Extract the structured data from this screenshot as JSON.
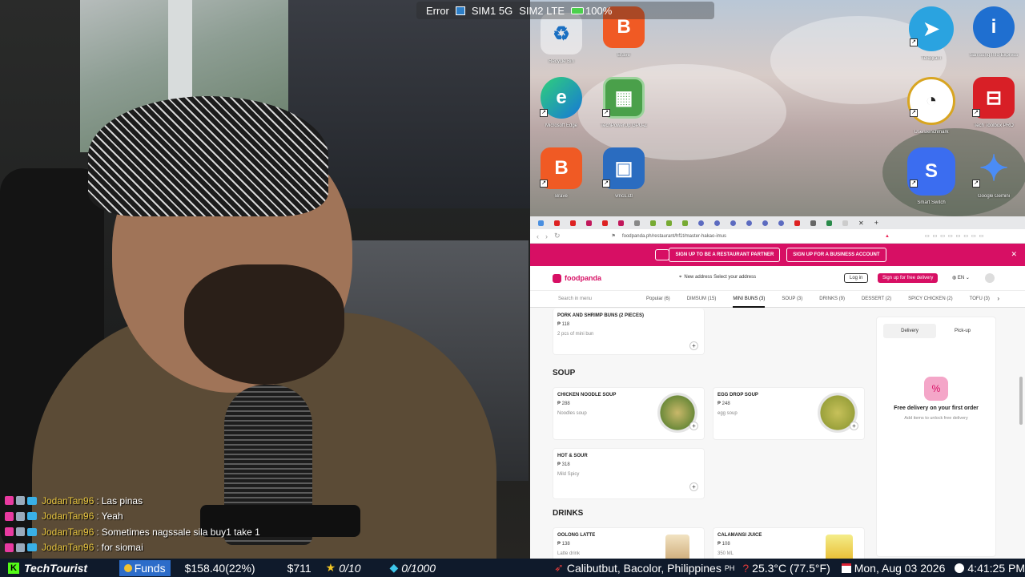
{
  "statusbar": {
    "error": "Error",
    "sim1": "SIM1 5G",
    "sim2": "SIM2 LTE",
    "battery": "100%"
  },
  "chat": [
    {
      "user": "JodanTan96",
      "msg": "Las pinas"
    },
    {
      "user": "JodanTan96",
      "msg": "Yeah"
    },
    {
      "user": "JodanTan96",
      "msg": "Sometimes nagssale sila buy1 take 1"
    },
    {
      "user": "JodanTan96",
      "msg": "for siomai"
    }
  ],
  "desktop": {
    "icons": [
      {
        "name": "recycle-bin-icon",
        "label": "Recycle Bin"
      },
      {
        "name": "brave-icon",
        "label": "Brave"
      },
      {
        "name": "edge-icon",
        "label": "Microsoft Edge"
      },
      {
        "name": "bios-chip-icon",
        "label": "TechPowerUp GPU-Z"
      },
      {
        "name": "brave-icon",
        "label": "Brave"
      },
      {
        "name": "remote-pc-icon",
        "label": "vmcs.ctl"
      },
      {
        "name": "telegram-icon",
        "label": "Telegram"
      },
      {
        "name": "info-icon",
        "label": "Samsung Info Express"
      },
      {
        "name": "speedometer-icon",
        "label": "UserBenchmark"
      },
      {
        "name": "toolbox-icon",
        "label": "Tech Toolbox PRO"
      },
      {
        "name": "smart-switch-icon",
        "label": "Smart Switch"
      },
      {
        "name": "gemini-icon",
        "label": "Google Gemini"
      }
    ]
  },
  "browser": {
    "url": "foodpanda.ph/restaurant/hf1t/master-hakao-imus",
    "banner": {
      "partner": "SIGN UP TO BE A RESTAURANT PARTNER",
      "business": "SIGN UP FOR A BUSINESS ACCOUNT"
    },
    "header": {
      "brand": "foodpanda",
      "address": "New address Select your address",
      "login": "Log in",
      "signup": "Sign up for free delivery",
      "lang": "EN"
    },
    "menu": {
      "search_placeholder": "Search in menu",
      "tabs": [
        "Popular (6)",
        "DIMSUM (15)",
        "MINI BUNS (3)",
        "SOUP (3)",
        "DRINKS (9)",
        "DESSERT (2)",
        "SPICY CHICKEN (2)",
        "TOFU (3)"
      ]
    },
    "items": {
      "bun": {
        "name": "PORK AND SHRIMP BUNS (2 PIECES)",
        "price": "₱ 118",
        "desc": "2 pcs of mini bun"
      },
      "soup_title": "SOUP",
      "chicken": {
        "name": "CHICKEN NOODLE SOUP",
        "price": "₱ 288",
        "desc": "Noodles soup"
      },
      "egg": {
        "name": "EGG DROP SOUP",
        "price": "₱ 248",
        "desc": "egg soup"
      },
      "hot": {
        "name": "HOT & SOUR",
        "price": "₱ 318",
        "desc": "Mild Spicy"
      },
      "drinks_title": "DRINKS",
      "oolong": {
        "name": "OOLONG LATTE",
        "price": "₱ 138",
        "desc": "Latte drink"
      },
      "calamansi": {
        "name": "CALAMANSI JUICE",
        "price": "₱ 108",
        "desc": "350 ML"
      }
    },
    "cart": {
      "delivery": "Delivery",
      "pickup": "Pick-up",
      "title": "Free delivery on your first order",
      "sub": "Add items to unlock free delivery"
    }
  },
  "ticker": {
    "brand": "TechTourist",
    "funds": "Funds",
    "amount": "$158.40(22%)",
    "cash": "$711",
    "stars": "0/10",
    "gems": "0/1000",
    "location": "Calibutbut, Bacolor, Philippines",
    "country": "PH",
    "temp": "25.3°C (77.5°F)",
    "date": "Mon, Aug 03 2026",
    "time": "4:41:25 PM"
  }
}
